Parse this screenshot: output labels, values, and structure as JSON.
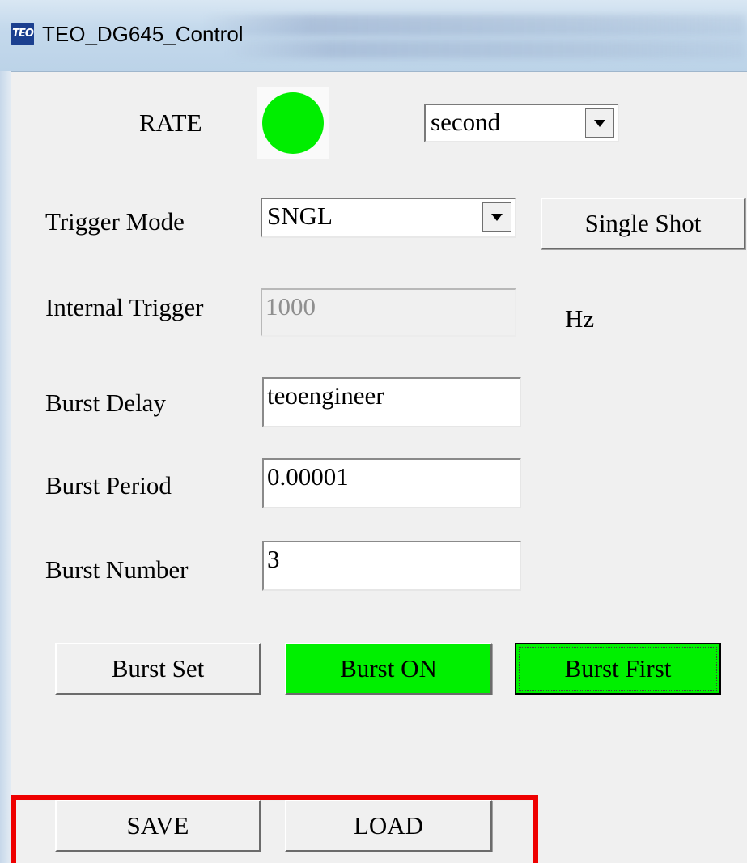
{
  "window": {
    "title": "TEO_DG645_Control",
    "app_icon_text": "TEO"
  },
  "rate": {
    "label": "RATE",
    "indicator_color": "#00ee00",
    "unit_selected": "second"
  },
  "trigger_mode": {
    "label": "Trigger Mode",
    "selected": "SNGL",
    "single_shot_label": "Single Shot"
  },
  "internal_trigger": {
    "label": "Internal Trigger",
    "value": "1000",
    "unit": "Hz",
    "enabled": false
  },
  "burst_delay": {
    "label": "Burst Delay",
    "value": "teoengineer"
  },
  "burst_period": {
    "label": "Burst Period",
    "value": "0.00001"
  },
  "burst_number": {
    "label": "Burst Number",
    "value": "3"
  },
  "burst_buttons": {
    "set_label": "Burst Set",
    "on_label": "Burst ON",
    "first_label": "Burst First",
    "active_color": "#00f000"
  },
  "file_buttons": {
    "save_label": "SAVE",
    "load_label": "LOAD",
    "highlight_color": "#ee0000"
  }
}
